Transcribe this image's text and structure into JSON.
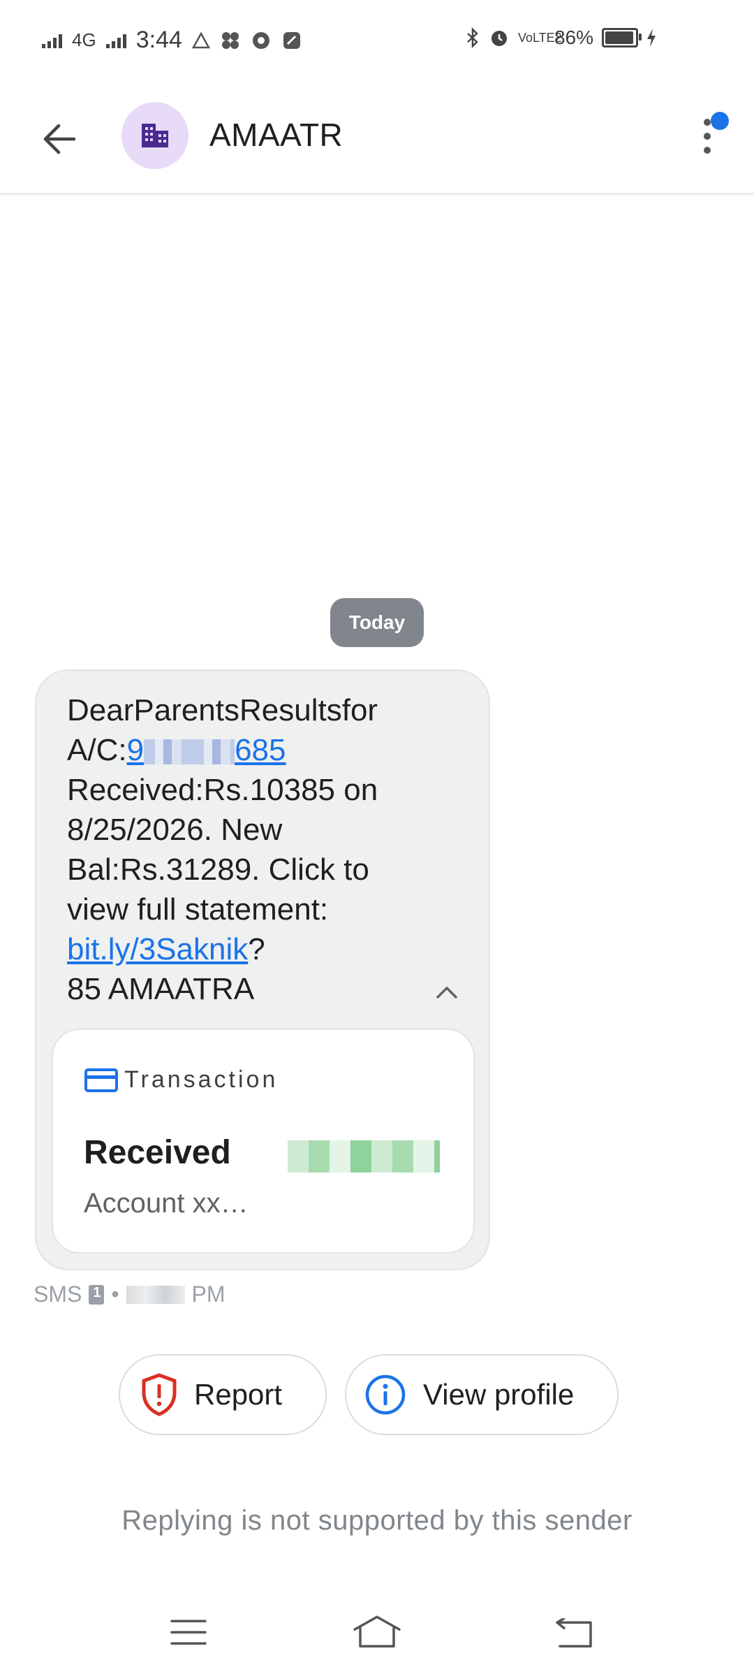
{
  "status_bar": {
    "network": "4G",
    "time": "3:44",
    "volte": "VoLTE2",
    "battery_percent": "86%",
    "battery_level": 0.86
  },
  "app_bar": {
    "title": "AMAATR",
    "avatar_icon": "building-icon",
    "accent_badge_color": "#1a73e8"
  },
  "conversation": {
    "date_chip": "Today",
    "message": {
      "line1": "DearParentsResultsfor",
      "acct_prefix": "A/C:",
      "acct_link_start": "9",
      "acct_link_end": "685",
      "line3": "Received:Rs.10385 on",
      "line4": "8/25/2026. New",
      "line5": "Bal:Rs.31289. Click to",
      "line6": "view full statement:",
      "link": "bit.ly/3Saknik",
      "link_suffix": "?",
      "line8": "85 AMAATRA"
    },
    "card": {
      "category": "Transaction",
      "primary": "Received",
      "secondary": "Account xx…"
    },
    "meta": {
      "channel": "SMS",
      "separator": "•",
      "time_suffix": "PM"
    }
  },
  "actions": {
    "report": "Report",
    "view_profile": "View profile"
  },
  "reply_note": "Replying is not supported by this sender",
  "colors": {
    "bubble": "#eff0f0",
    "link": "#1a73e8",
    "report_icon": "#d93025",
    "info_icon": "#1a73e8"
  }
}
